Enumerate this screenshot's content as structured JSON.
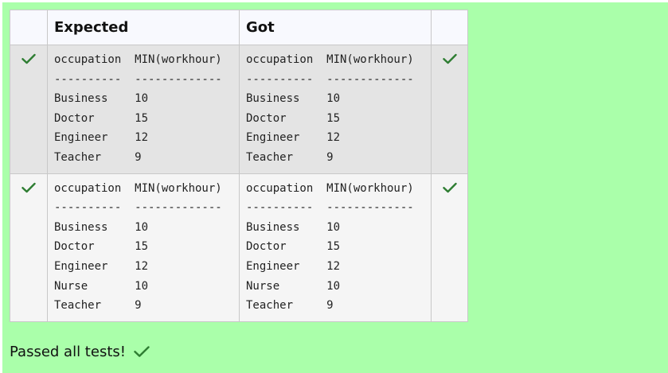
{
  "table": {
    "headers": {
      "expected": "Expected",
      "got": "Got"
    },
    "rows": [
      {
        "expected": "occupation  MIN(workhour)\n----------  -------------\nBusiness    10\nDoctor      15\nEngineer    12\nTeacher     9",
        "got": "occupation  MIN(workhour)\n----------  -------------\nBusiness    10\nDoctor      15\nEngineer    12\nTeacher     9",
        "passed": true
      },
      {
        "expected": "occupation  MIN(workhour)\n----------  -------------\nBusiness    10\nDoctor      15\nEngineer    12\nNurse       10\nTeacher     9",
        "got": "occupation  MIN(workhour)\n----------  -------------\nBusiness    10\nDoctor      15\nEngineer    12\nNurse       10\nTeacher     9",
        "passed": true
      }
    ]
  },
  "summary": {
    "text": "Passed all tests!"
  },
  "icons": {
    "check": "check-icon"
  },
  "colors": {
    "background": "#aaffaa",
    "check": "#2e7d32",
    "header_bg": "#f8f9fe",
    "row_odd_bg": "#e4e4e4",
    "row_even_bg": "#f5f5f5"
  }
}
